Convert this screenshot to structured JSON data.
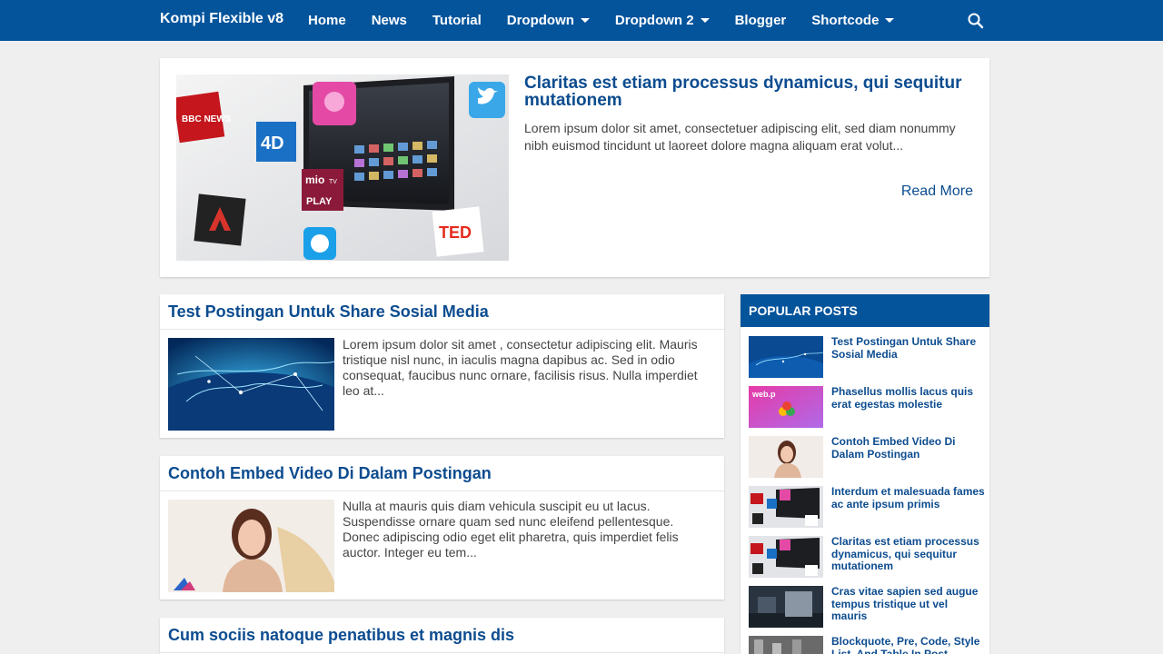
{
  "site": {
    "brand": "Kompi Flexible v8"
  },
  "nav": [
    {
      "label": "Home",
      "dropdown": false
    },
    {
      "label": "News",
      "dropdown": false
    },
    {
      "label": "Tutorial",
      "dropdown": false
    },
    {
      "label": "Dropdown",
      "dropdown": true
    },
    {
      "label": "Dropdown 2",
      "dropdown": true
    },
    {
      "label": "Blogger",
      "dropdown": false
    },
    {
      "label": "Shortcode",
      "dropdown": true
    }
  ],
  "icons": {
    "search": "search-icon"
  },
  "colors": {
    "accent": "#04549c",
    "link": "#0c4c8f",
    "background": "#efefef"
  },
  "featured": {
    "title": "Claritas est etiam processus dynamicus, qui sequitur mutationem",
    "snippet": "Lorem ipsum dolor sit amet, consectetuer adipiscing elit, sed diam nonummy nibh euismod tincidunt ut laoreet dolore magna aliquam erat volut...",
    "read_more": "Read More",
    "image_labels": {
      "bbc": "BBC NEWS",
      "fourd": "4D",
      "mio_top": "mio",
      "mio_mid": "TV",
      "mio_bottom": "PLAY",
      "ted": "TED"
    }
  },
  "posts": [
    {
      "title": "Test Postingan Untuk Share Sosial Media",
      "snippet": "Lorem ipsum dolor sit amet , consectetur adipiscing elit. Mauris tristique nisl nunc, in iaculis magna dapibus ac. Sed in odio consequat, faucibus nunc ornare, facilisis risus. Nulla imperdiet leo at..."
    },
    {
      "title": "Contoh Embed Video Di Dalam Postingan",
      "snippet": "Nulla at mauris quis diam vehicula suscipit eu ut lacus. Suspendisse ornare quam sed nunc eleifend pellentesque. Donec adipiscing odio eget elit pharetra, quis imperdiet felis auctor. Integer eu tem..."
    },
    {
      "title": "Cum sociis natoque penatibus et magnis dis",
      "snippet": ""
    }
  ],
  "sidebar": {
    "heading": "POPULAR POSTS",
    "items": [
      {
        "title": "Test Postingan Untuk Share Sosial Media"
      },
      {
        "title": "Phasellus mollis lacus quis erat egestas molestie",
        "thumb_text": "web.p"
      },
      {
        "title": "Contoh Embed Video Di Dalam Postingan"
      },
      {
        "title": "Interdum et malesuada fames ac ante ipsum primis"
      },
      {
        "title": "Claritas est etiam processus dynamicus, qui sequitur mutationem"
      },
      {
        "title": "Cras vitae sapien sed augue tempus tristique ut vel mauris"
      },
      {
        "title": "Blockquote, Pre, Code, Style List, And Table In Post"
      }
    ]
  }
}
